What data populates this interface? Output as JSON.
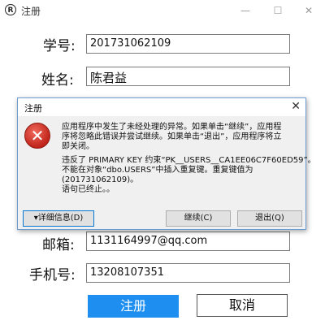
{
  "window": {
    "icon_glyph": "R",
    "title": "注册",
    "controls": {
      "minimize": "—",
      "maximize": "☐",
      "close": "✕"
    }
  },
  "form": {
    "student_id": {
      "label": "学号:",
      "value": "201731062109"
    },
    "name": {
      "label": "姓名:",
      "value": "陈君益"
    },
    "email": {
      "label": "邮箱:",
      "value": "1131164997@qq.com"
    },
    "phone": {
      "label": "手机号:",
      "value": "13208107351"
    },
    "register_label": "注册",
    "cancel_label": "取消"
  },
  "dialog": {
    "title": "注册",
    "close_glyph": "✕",
    "icon": "error-x-icon",
    "message_lines": [
      "应用程序中发生了未经处理的异常。如果单击“继续”，应用程",
      "序将忽略此错误并尝试继续。如果单击“退出”，应用程序将立",
      "即关闭。",
      "违反了 PRIMARY KEY 约束“PK__USERS__CA1EE06C7F60ED59”。",
      "不能在对象“dbo.USERS”中插入重复键。重复键值为",
      "(201731062109)。",
      "语句已终止。。"
    ],
    "details_label": "▾详细信息(D)",
    "continue_label": "继续(C)",
    "quit_label": "退出(Q)"
  },
  "colors": {
    "register_button": "#1e8ff0",
    "dialog_border": "#6b9bd1",
    "error_icon": "#c1241a"
  }
}
